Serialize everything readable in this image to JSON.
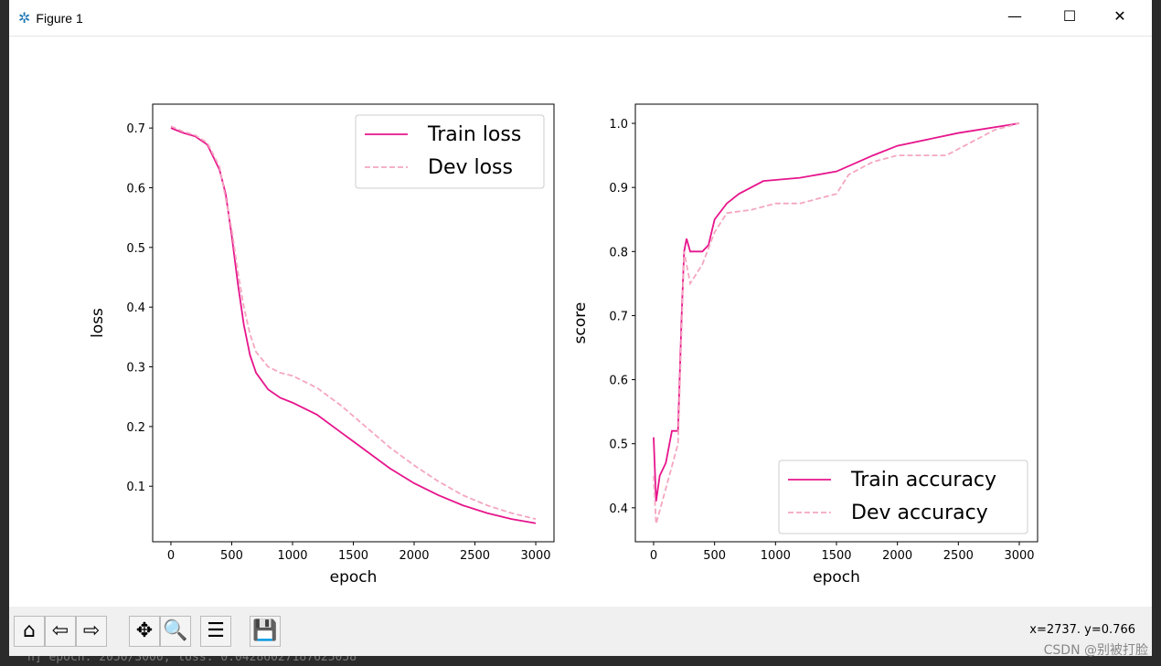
{
  "window": {
    "title": "Figure 1",
    "minimize": "—",
    "maximize": "☐",
    "close": "✕"
  },
  "toolbar": {
    "buttons": [
      {
        "name": "home",
        "glyph": "⌂"
      },
      {
        "name": "back",
        "glyph": "⇦"
      },
      {
        "name": "forward",
        "glyph": "⇨"
      },
      {
        "name": "pan",
        "glyph": "✥"
      },
      {
        "name": "zoom",
        "glyph": "🔍"
      },
      {
        "name": "configure-subplots",
        "glyph": "☰"
      },
      {
        "name": "save",
        "glyph": "💾"
      }
    ],
    "coords": "x=2737. y=0.766"
  },
  "watermark": "CSDN @别被打脸",
  "console_text": "n] epoch: 2050/3000, loss: 0.04286027187625058",
  "colors": {
    "train": "#e6158c",
    "dev": "#f4a6c0"
  },
  "chart_data": [
    {
      "type": "line",
      "xlabel": "epoch",
      "ylabel": "loss",
      "xlim": [
        -150,
        3150
      ],
      "ylim": [
        0.007,
        0.74
      ],
      "xticks": [
        0,
        500,
        1000,
        1500,
        2000,
        2500,
        3000
      ],
      "yticks": [
        0.1,
        0.2,
        0.3,
        0.4,
        0.5,
        0.6,
        0.7
      ],
      "legend": "top-right",
      "series": [
        {
          "name": "Train loss",
          "style": "solid",
          "x": [
            0,
            100,
            200,
            300,
            400,
            450,
            500,
            550,
            600,
            650,
            700,
            800,
            900,
            1000,
            1200,
            1400,
            1600,
            1800,
            2000,
            2200,
            2400,
            2600,
            2800,
            3000
          ],
          "y": [
            0.7,
            0.692,
            0.686,
            0.672,
            0.63,
            0.59,
            0.52,
            0.44,
            0.37,
            0.32,
            0.29,
            0.262,
            0.248,
            0.24,
            0.22,
            0.19,
            0.16,
            0.13,
            0.105,
            0.085,
            0.068,
            0.055,
            0.045,
            0.038
          ]
        },
        {
          "name": "Dev loss",
          "style": "dashed",
          "x": [
            0,
            100,
            200,
            300,
            400,
            500,
            550,
            600,
            650,
            700,
            800,
            900,
            1000,
            1200,
            1400,
            1600,
            1800,
            2000,
            2200,
            2400,
            2600,
            2800,
            3000
          ],
          "y": [
            0.703,
            0.694,
            0.688,
            0.675,
            0.635,
            0.53,
            0.46,
            0.4,
            0.355,
            0.325,
            0.3,
            0.29,
            0.285,
            0.265,
            0.235,
            0.2,
            0.165,
            0.135,
            0.108,
            0.085,
            0.068,
            0.055,
            0.045
          ]
        }
      ]
    },
    {
      "type": "line",
      "xlabel": "epoch",
      "ylabel": "score",
      "xlim": [
        -150,
        3150
      ],
      "ylim": [
        0.347,
        1.03
      ],
      "xticks": [
        0,
        500,
        1000,
        1500,
        2000,
        2500,
        3000
      ],
      "yticks": [
        0.4,
        0.5,
        0.6,
        0.7,
        0.8,
        0.9,
        1.0
      ],
      "legend": "bottom-right",
      "series": [
        {
          "name": "Train accuracy",
          "style": "solid",
          "x": [
            0,
            20,
            50,
            100,
            150,
            200,
            230,
            250,
            270,
            300,
            400,
            450,
            500,
            600,
            700,
            900,
            1200,
            1500,
            1800,
            2000,
            2500,
            3000
          ],
          "y": [
            0.51,
            0.41,
            0.45,
            0.47,
            0.52,
            0.52,
            0.7,
            0.8,
            0.82,
            0.8,
            0.8,
            0.81,
            0.85,
            0.875,
            0.89,
            0.91,
            0.915,
            0.925,
            0.95,
            0.965,
            0.985,
            1.0
          ]
        },
        {
          "name": "Dev accuracy",
          "style": "dashed",
          "x": [
            0,
            20,
            100,
            200,
            250,
            300,
            400,
            500,
            600,
            800,
            1000,
            1200,
            1500,
            1600,
            1800,
            2000,
            2400,
            2600,
            2800,
            3000
          ],
          "y": [
            0.45,
            0.375,
            0.43,
            0.5,
            0.8,
            0.75,
            0.78,
            0.83,
            0.86,
            0.865,
            0.875,
            0.875,
            0.89,
            0.92,
            0.94,
            0.95,
            0.95,
            0.97,
            0.99,
            1.0
          ]
        }
      ]
    }
  ]
}
